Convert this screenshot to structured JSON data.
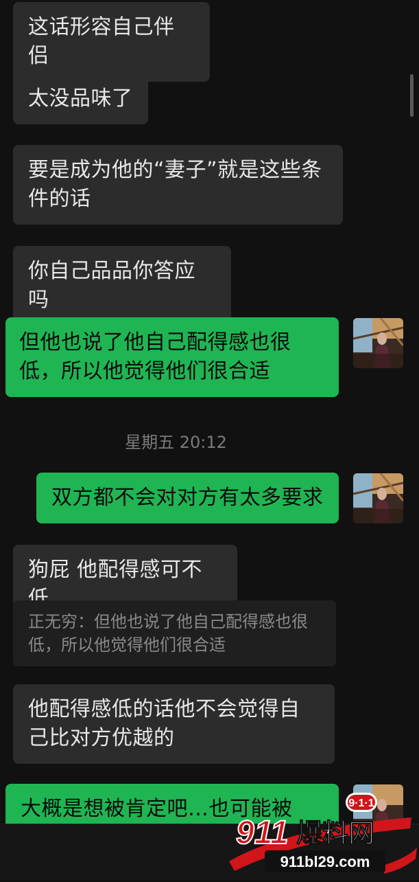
{
  "messages": [
    {
      "text": "这话形容自己伴侣"
    },
    {
      "text": "太没品味了"
    },
    {
      "text": "要是成为他的“妻子”就是这些条件的话"
    },
    {
      "text": "你自己品品你答应吗"
    },
    {
      "text": "但他也说了他自己配得感也很低，所以他觉得他们很合适"
    },
    {
      "text": "双方都不会对对方有太多要求"
    },
    {
      "text": "狗屁 他配得感可不低"
    },
    {
      "text": "他配得感低的话他不会觉得自己比对方优越的"
    },
    {
      "text": "大概是想被肯定吧…也可能被 pua"
    }
  ],
  "timestamp": "星期五 20:12",
  "quote": {
    "text": "正无穷：但他也说了他自己配得感也很低，所以他觉得他们很合适"
  },
  "colors": {
    "background": "#111111",
    "incoming_bubble": "#2c2c2c",
    "outgoing_bubble": "#1fb553"
  },
  "watermark": {
    "logo": "911爆料网",
    "url": "911bl29.com"
  }
}
